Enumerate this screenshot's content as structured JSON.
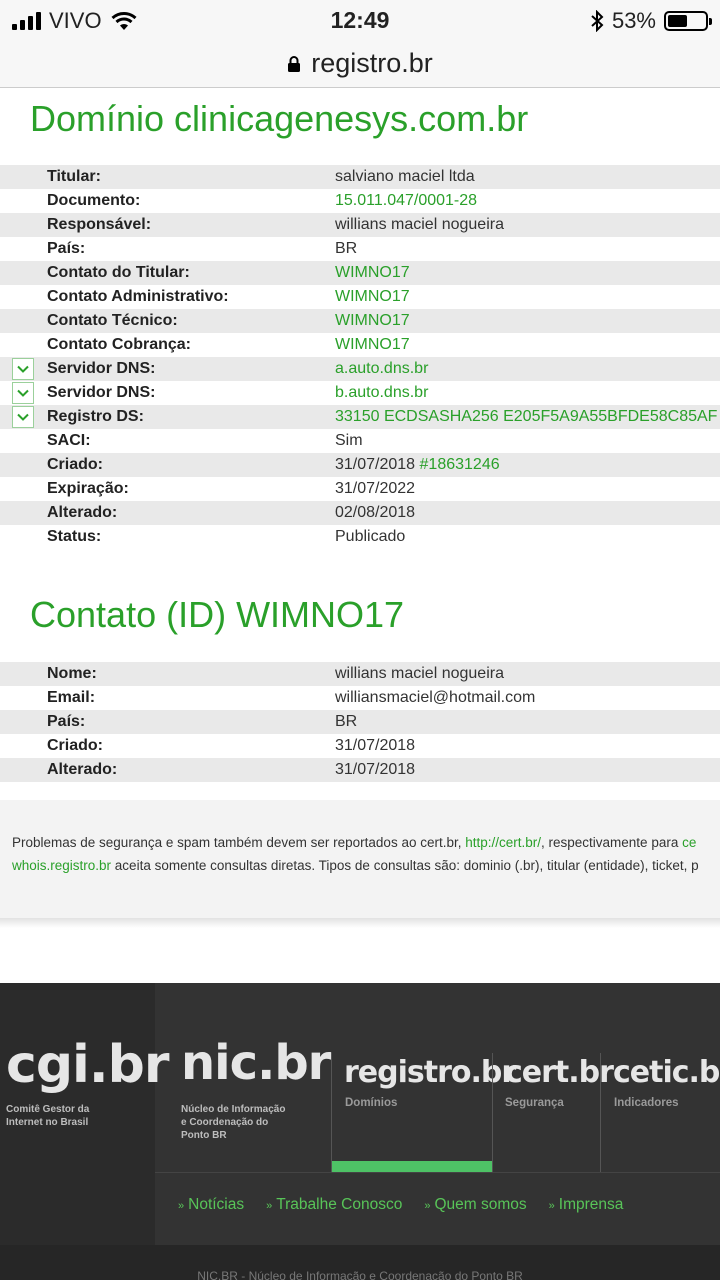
{
  "status_bar": {
    "carrier": "VIVO",
    "time": "12:49",
    "battery": "53%",
    "battery_level": 0.53
  },
  "url_bar": {
    "domain": "registro.br"
  },
  "domain_section": {
    "title": "Domínio clinicagenesys.com.br",
    "rows": [
      {
        "label": "Titular:",
        "value": "salviano maciel ltda"
      },
      {
        "label": "Documento:",
        "value": "15.011.047/0001-28"
      },
      {
        "label": "Responsável:",
        "value": "willians maciel nogueira"
      },
      {
        "label": "País:",
        "value": "BR"
      },
      {
        "label": "Contato do Titular:",
        "value": "WIMNO17"
      },
      {
        "label": "Contato Administrativo:",
        "value": "WIMNO17"
      },
      {
        "label": "Contato Técnico:",
        "value": "WIMNO17"
      },
      {
        "label": "Contato Cobrança:",
        "value": "WIMNO17"
      },
      {
        "label": "Servidor DNS:",
        "value": "a.auto.dns.br"
      },
      {
        "label": "Servidor DNS:",
        "value": "b.auto.dns.br"
      },
      {
        "label": "Registro DS:",
        "value": "33150 ECDSASHA256 E205F5A9A55BFDE58C85AF"
      },
      {
        "label": "SACI:",
        "value": "Sim"
      },
      {
        "label": "Criado:",
        "value": "31/07/2018",
        "extra": "#18631246"
      },
      {
        "label": "Expiração:",
        "value": "31/07/2022"
      },
      {
        "label": "Alterado:",
        "value": "02/08/2018"
      },
      {
        "label": "Status:",
        "value": "Publicado"
      }
    ]
  },
  "contact_section": {
    "title": "Contato (ID) WIMNO17",
    "rows": [
      {
        "label": "Nome:",
        "value": "willians maciel nogueira"
      },
      {
        "label": "Email:",
        "value": "williansmaciel@hotmail.com"
      },
      {
        "label": "País:",
        "value": "BR"
      },
      {
        "label": "Criado:",
        "value": "31/07/2018"
      },
      {
        "label": "Alterado:",
        "value": "31/07/2018"
      }
    ]
  },
  "notice": {
    "line1_text": "Problemas de segurança e spam também devem ser reportados ao cert.br, ",
    "line1_link": "http://cert.br/",
    "line1_tail": ", respectivamente para ",
    "line1_cut": "ce",
    "line2_link": "whois.registro.br",
    "line2_text": " aceita somente consultas diretas. Tipos de consultas são: dominio (.br), titular (entidade), ticket, p"
  },
  "footer": {
    "cgi": {
      "name": "cgi.br",
      "sub1": "Comitê Gestor da",
      "sub2": "Internet no Brasil"
    },
    "nic": {
      "name": "nic.br",
      "sub1": "Núcleo de Informação",
      "sub2": "e Coordenação do",
      "sub3": "Ponto BR"
    },
    "registro": {
      "name": "registro.br",
      "sub": "Domínios"
    },
    "cert": {
      "name": "cert.br",
      "sub": "Segurança"
    },
    "cetic": {
      "name": "cetic.br",
      "sub": "Indicadores"
    },
    "links": [
      "Notícias",
      "Trabalhe Conosco",
      "Quem somos",
      "Imprensa"
    ],
    "bottom_text": "NIC.BR - Núcleo de Informação e Coordenação do Ponto BR"
  },
  "colors": {
    "accent": "#2aa02a",
    "footer_bg": "#333333",
    "active_tab": "#4ec266"
  }
}
